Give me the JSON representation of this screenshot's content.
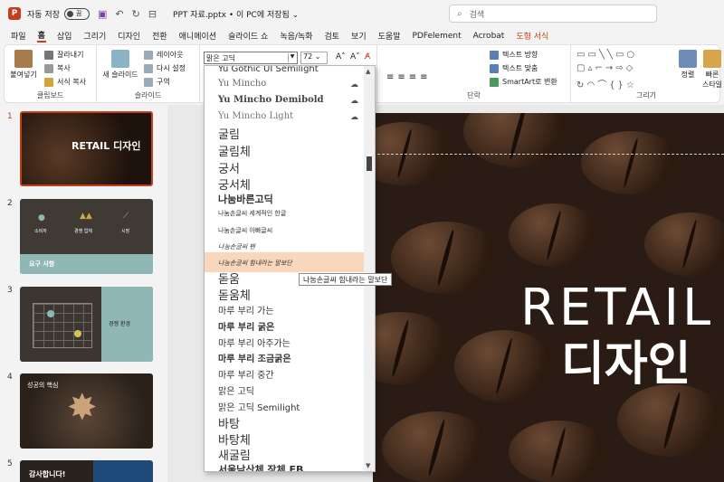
{
  "titlebar": {
    "autosave_label": "자동 저장",
    "autosave_state": "끔",
    "doc_title": "PPT 자료.pptx • 이 PC에 저장됨 ⌄",
    "search_placeholder": "검색"
  },
  "tabs": [
    "파일",
    "홈",
    "삽입",
    "그리기",
    "디자인",
    "전환",
    "애니메이션",
    "슬라이드 쇼",
    "녹음/녹화",
    "검토",
    "보기",
    "도움말",
    "PDFelement",
    "Acrobat",
    "도형 서식"
  ],
  "active_tab": "홈",
  "ribbon": {
    "clipboard": {
      "paste": "붙여넣기",
      "cut": "잘라내기",
      "copy": "복사",
      "format_painter": "서식 복사",
      "label": "클립보드"
    },
    "slides": {
      "new_slide": "새 슬라이드",
      "layout": "레이아웃",
      "reset": "다시 설정",
      "section": "구역",
      "label": "슬라이드"
    },
    "font": {
      "name": "맑은 고딕",
      "size": "72"
    },
    "paragraph": {
      "text_direction": "텍스트 방향",
      "align_text": "텍스트 맞춤",
      "smartart": "SmartArt로 변환",
      "label": "단락"
    },
    "drawing": {
      "arrange": "정렬",
      "quick_styles": "빠른 스타일",
      "label": "그리기"
    }
  },
  "font_list": {
    "items": [
      "Yu Gothic UI Semilight",
      "Yu Mincho",
      "Yu Mincho Demibold",
      "Yu Mincho Light",
      "굴림",
      "굴림체",
      "궁서",
      "궁서체",
      "나눔바른고딕",
      "나눔손글씨 세계적인 한글",
      "나눔손글씨 아빠글씨",
      "나눔손글씨 펜",
      "나눔손글씨 힘내라는 말보단",
      "돋움",
      "돋움체",
      "마루 부리 가는",
      "마루 부리 굵은",
      "마루 부리 아주가는",
      "마루 부리 조금굵은",
      "마루 부리 중간",
      "맑은 고딕",
      "맑은 고딕 Semilight",
      "바탕",
      "바탕체",
      "새굴림",
      "서울남산체 장체 EB"
    ],
    "highlighted": "나눔손글씨 힘내라는 말보단",
    "tooltip": "나눔손글씨 힘내라는 말보단"
  },
  "slides": [
    {
      "num": "1",
      "title": "RETAIL 디자인",
      "selected": true
    },
    {
      "num": "2",
      "icons": [
        "소비자",
        "경쟁 업체",
        "시장"
      ],
      "caption": "요구 사항"
    },
    {
      "num": "3",
      "caption": "경쟁 환경"
    },
    {
      "num": "4",
      "caption": "성공의 핵심"
    },
    {
      "num": "5",
      "caption": "감사합니다!"
    }
  ],
  "main_slide": {
    "line1": "RETAIL",
    "line2": "디자인"
  },
  "colors": {
    "accent": "#c43e1c",
    "highlight": "#f9d7bd",
    "teal": "#8fb7b6"
  }
}
